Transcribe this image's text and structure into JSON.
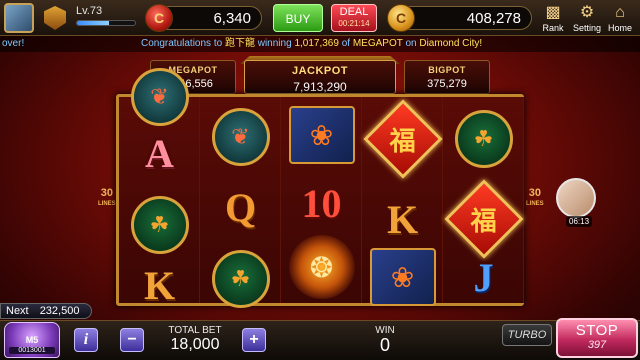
{
  "player": {
    "level": "Lv.73",
    "xp_progress_percent": 55
  },
  "balances": {
    "chips": "6,340",
    "coins": "408,278"
  },
  "header": {
    "buy_label": "BUY",
    "deal_label": "DEAL",
    "deal_timer": "00:21:14",
    "rank_label": "Rank",
    "setting_label": "Setting",
    "home_label": "Home"
  },
  "ticker": {
    "left_text": "over!",
    "prefix": "Congratulations to",
    "player_name": "跑下龍",
    "winning": "winning",
    "amount": "1,017,369",
    "of": "of",
    "prize": "MEGAPOT",
    "on": "on",
    "game": "Diamond City!"
  },
  "jackpots": {
    "megapot_label": "MEGAPOT",
    "megapot_value": "946,556",
    "jackpot_label": "JACKPOT",
    "jackpot_value": "7,913,290",
    "bigpot_label": "BIGPOT",
    "bigpot_value": "375,279"
  },
  "lines": {
    "count": "30",
    "label": "LINES"
  },
  "reels": [
    [
      "fish-medal",
      "A",
      "tiger-medal",
      "K"
    ],
    [
      "koi-medal",
      "Q",
      "tiger-medal"
    ],
    [
      "phoenix",
      "10",
      "dragon"
    ],
    [
      "fortune",
      "K",
      "phoenix"
    ],
    [
      "tiger-medal",
      "fortune",
      "J"
    ]
  ],
  "symbols": {
    "fortune_char": "福"
  },
  "side_player": {
    "time": "06:13"
  },
  "next": {
    "label": "Next",
    "value": "232,500"
  },
  "vip": {
    "level": "M5",
    "progress_text": "0013001"
  },
  "bet": {
    "label": "TOTAL BET",
    "value": "18,000"
  },
  "win": {
    "label": "WIN",
    "value": "0"
  },
  "controls": {
    "turbo_label": "TURBO",
    "stop_label": "STOP",
    "stop_count": "397"
  }
}
